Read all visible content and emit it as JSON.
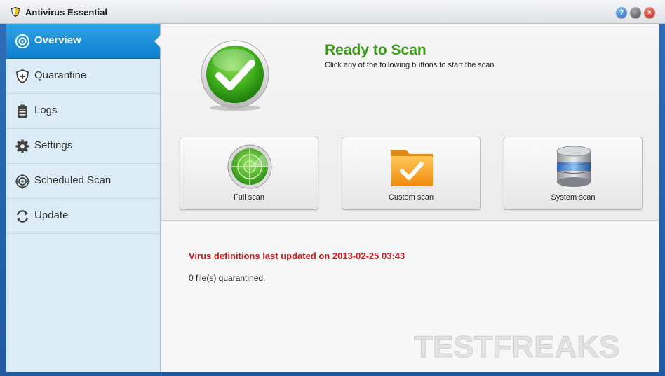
{
  "app": {
    "title": "Antivirus Essential"
  },
  "window_buttons": {
    "help": "?",
    "minimize": "",
    "close": "×"
  },
  "sidebar": {
    "items": [
      {
        "label": "Overview",
        "icon": "eye-icon"
      },
      {
        "label": "Quarantine",
        "icon": "shield-icon"
      },
      {
        "label": "Logs",
        "icon": "clipboard-icon"
      },
      {
        "label": "Settings",
        "icon": "gear-icon"
      },
      {
        "label": "Scheduled Scan",
        "icon": "target-icon"
      },
      {
        "label": "Update",
        "icon": "refresh-icon"
      }
    ],
    "active_index": 0
  },
  "status": {
    "title": "Ready to Scan",
    "subtitle": "Click any of the following buttons to start the scan."
  },
  "scan_buttons": [
    {
      "label": "Full scan",
      "icon": "radar-icon"
    },
    {
      "label": "Custom scan",
      "icon": "folder-check-icon"
    },
    {
      "label": "System scan",
      "icon": "database-icon"
    }
  ],
  "info": {
    "definitions": "Virus definitions last updated on 2013-02-25 03:43",
    "quarantined": "0 file(s) quarantined."
  },
  "watermark": {
    "text": "TESTFREAKS"
  },
  "colors": {
    "accent": "#0e7fcf",
    "status_green": "#3b9a18",
    "warning_red": "#d21a1a",
    "sidebar_bg": "#dcecf6"
  }
}
